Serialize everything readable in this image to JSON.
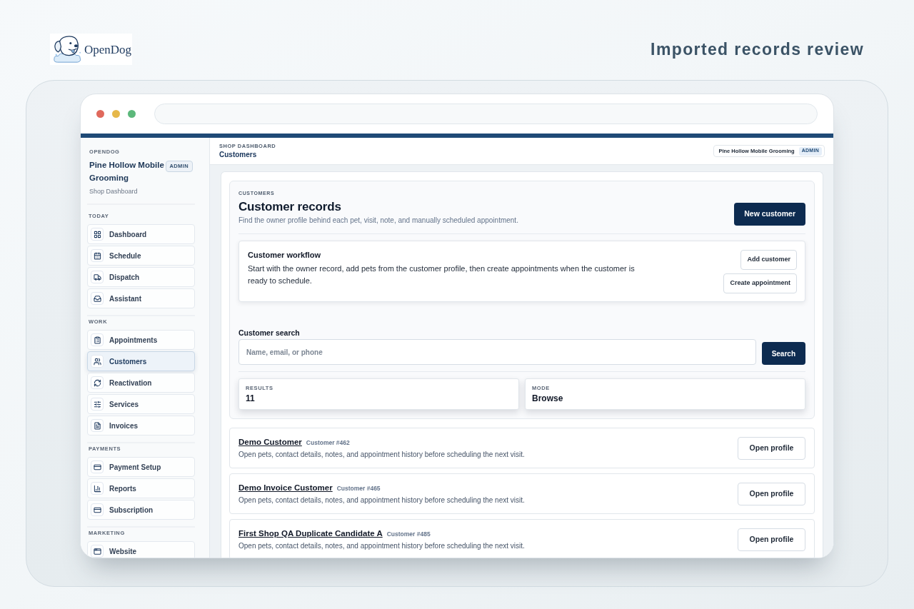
{
  "brand": {
    "logo_text": "OpenDog",
    "page_title": "Imported records review"
  },
  "sidebar": {
    "eyebrow": "OPENDOG",
    "shop_name": "Pine Hollow Mobile Grooming",
    "role_badge": "ADMIN",
    "subtitle": "Shop Dashboard",
    "sections": [
      {
        "heading": "TODAY",
        "items": [
          {
            "label": "Dashboard",
            "selected": false
          },
          {
            "label": "Schedule",
            "selected": false
          },
          {
            "label": "Dispatch",
            "selected": false
          },
          {
            "label": "Assistant",
            "selected": false
          }
        ]
      },
      {
        "heading": "WORK",
        "items": [
          {
            "label": "Appointments",
            "selected": false
          },
          {
            "label": "Customers",
            "selected": true
          },
          {
            "label": "Reactivation",
            "selected": false
          },
          {
            "label": "Services",
            "selected": false
          },
          {
            "label": "Invoices",
            "selected": false
          }
        ]
      },
      {
        "heading": "PAYMENTS",
        "items": [
          {
            "label": "Payment Setup",
            "selected": false
          },
          {
            "label": "Reports",
            "selected": false
          },
          {
            "label": "Subscription",
            "selected": false
          }
        ]
      },
      {
        "heading": "MARKETING",
        "items": [
          {
            "label": "Website",
            "selected": false
          }
        ]
      }
    ]
  },
  "top_bar": {
    "eyebrow": "SHOP DASHBOARD",
    "title": "Customers",
    "shop_name": "Pine Hollow Mobile Grooming",
    "role_badge": "ADMIN"
  },
  "customers_panel": {
    "eyebrow": "CUSTOMERS",
    "title": "Customer records",
    "subtitle": "Find the owner profile behind each pet, visit, note, and manually scheduled appointment.",
    "primary_button": "New customer",
    "workflow": {
      "title": "Customer workflow",
      "text": "Start with the owner record, add pets from the customer profile, then create appointments when the customer is ready to schedule.",
      "buttons": [
        "Add customer",
        "Create appointment"
      ]
    },
    "search": {
      "label": "Customer search",
      "placeholder": "Name, email, or phone",
      "button": "Search"
    },
    "stats": [
      {
        "label": "RESULTS",
        "value": "11"
      },
      {
        "label": "MODE",
        "value": "Browse"
      }
    ]
  },
  "customers": [
    {
      "name": "Demo Customer",
      "number": "Customer #462",
      "description": "Open pets, contact details, notes, and appointment history before scheduling the next visit.",
      "button": "Open profile"
    },
    {
      "name": "Demo Invoice Customer",
      "number": "Customer #465",
      "description": "Open pets, contact details, notes, and appointment history before scheduling the next visit.",
      "button": "Open profile"
    },
    {
      "name": "First Shop QA Duplicate Candidate A",
      "number": "Customer #485",
      "description": "Open pets, contact details, notes, and appointment history before scheduling the next visit.",
      "button": "Open profile"
    }
  ]
}
